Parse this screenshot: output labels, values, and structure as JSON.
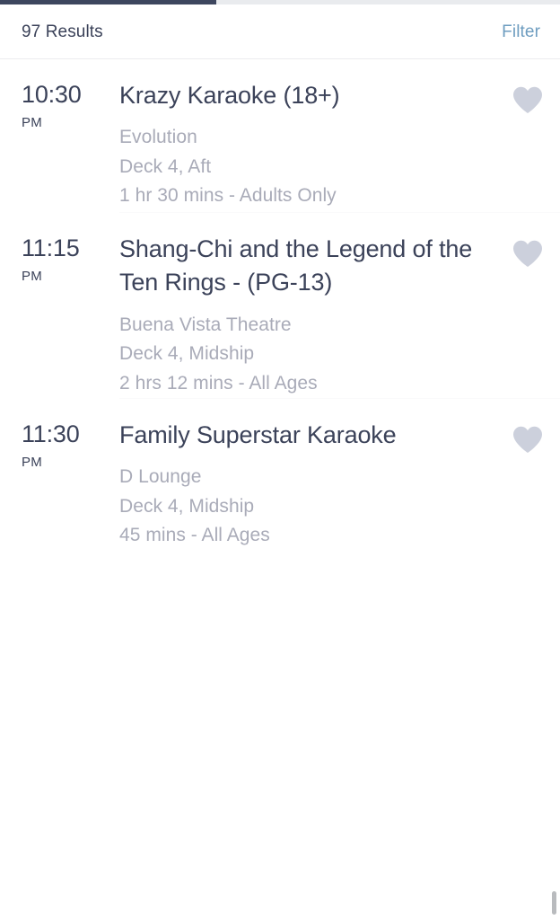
{
  "topbar": {
    "dark_color": "#3d465e",
    "light_color": "#e9ebee"
  },
  "header": {
    "results_label": "97 Results",
    "filter_label": "Filter",
    "filter_color": "#6e9dc0",
    "text_color": "#3b4259"
  },
  "colors": {
    "title": "#3b4259",
    "meta": "#a9abb8",
    "heart": "#ccd0dc",
    "divider": "#fafafb",
    "background": "#ffffff"
  },
  "events": [
    {
      "time": "10:30",
      "meridiem": "PM",
      "title": "Krazy Karaoke (18+)",
      "venue": "Evolution",
      "location": "Deck 4, Aft",
      "details": "1 hr 30 mins - Adults Only",
      "favorite_icon": "heart-icon",
      "favorited": false
    },
    {
      "time": "11:15",
      "meridiem": "PM",
      "title": "Shang-Chi and the Legend of the Ten Rings - (PG-13)",
      "venue": "Buena Vista Theatre",
      "location": "Deck 4, Midship",
      "details": "2 hrs 12 mins - All Ages",
      "favorite_icon": "heart-icon",
      "favorited": false
    },
    {
      "time": "11:30",
      "meridiem": "PM",
      "title": "Family Superstar Karaoke",
      "venue": "D Lounge",
      "location": "Deck 4, Midship",
      "details": "45 mins - All Ages",
      "favorite_icon": "heart-icon",
      "favorited": false
    }
  ]
}
